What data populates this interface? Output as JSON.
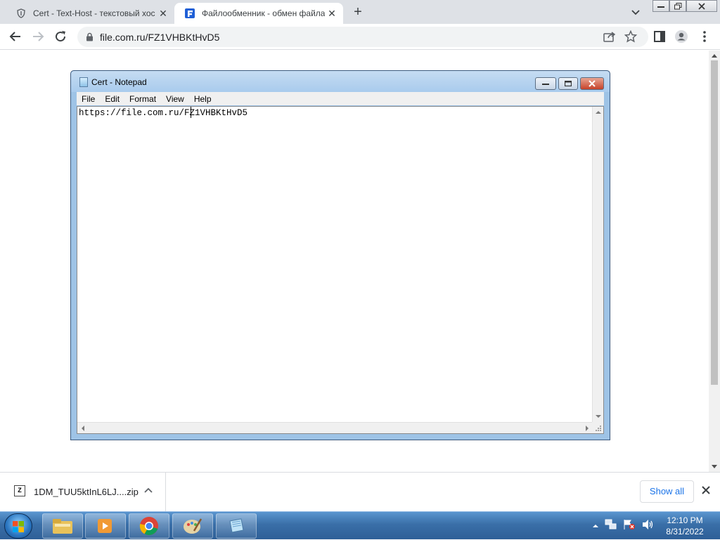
{
  "browser": {
    "tabs": [
      {
        "title": "Cert - Text-Host - текстовый хос",
        "active": false
      },
      {
        "title": "Файлообменник - обмен файла",
        "active": true
      }
    ],
    "close_glyph": "✕",
    "new_tab_glyph": "+",
    "address": "file.com.ru/FZ1VHBKtHvD5"
  },
  "notepad": {
    "title": "Cert - Notepad",
    "menu": [
      "File",
      "Edit",
      "Format",
      "View",
      "Help"
    ],
    "content": "https://file.com.ru/FZ1VHBKtHvD5"
  },
  "downloads": {
    "file_name": "1DM_TUU5ktInL6LJ....zip",
    "file_icon_letter": "Z",
    "show_all": "Show all"
  },
  "taskbar": {
    "time": "12:10 PM",
    "date": "8/31/2022"
  },
  "colors": {
    "chrome_tabstrip": "#dee1e6",
    "link_blue": "#1a73e8",
    "taskbar": "#3a6fa8",
    "notepad_frame": "#9ec3e6"
  }
}
